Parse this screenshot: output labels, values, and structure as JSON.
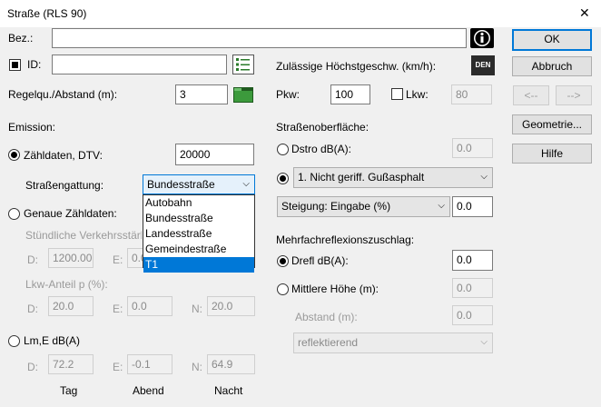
{
  "window": {
    "title": "Straße (RLS 90)",
    "close_glyph": "✕"
  },
  "bez": {
    "label": "Bez.:",
    "value": ""
  },
  "id": {
    "label": "ID:",
    "value": ""
  },
  "regelqu": {
    "label": "Regelqu./Abstand (m):",
    "value": "3"
  },
  "speed": {
    "label": "Zulässige Höchstgeschw. (km/h):",
    "den_label": "DEN",
    "pkw_label": "Pkw:",
    "pkw_value": "100",
    "lkw_label": "Lkw:",
    "lkw_value": "80"
  },
  "buttons": {
    "ok": "OK",
    "cancel": "Abbruch",
    "prev": "<--",
    "next": "-->",
    "geometry": "Geometrie...",
    "help": "Hilfe"
  },
  "emission": {
    "heading": "Emission:",
    "dtv_label": "Zähldaten, DTV:",
    "dtv_value": "20000",
    "road_type_label": "Straßengattung:",
    "road_type_selected": "Bundesstraße",
    "road_type_options": [
      "Autobahn",
      "Bundesstraße",
      "Landesstraße",
      "Gemeindestraße",
      "T1"
    ],
    "exact_label": "Genaue Zähldaten:",
    "traffic_label": "Stündliche Verkehrsstärke M (Kfz/h):",
    "traffic_d_label": "D:",
    "traffic_d_value": "1200.00",
    "traffic_e_label": "E:",
    "traffic_e_value": "0.0",
    "lkw_label": "Lkw-Anteil p (%):",
    "lkw_d_label": "D:",
    "lkw_d_value": "20.0",
    "lkw_e_label": "E:",
    "lkw_e_value": "0.0",
    "lkw_n_label": "N:",
    "lkw_n_value": "20.0",
    "lme_label": "Lm,E dB(A)",
    "lme_d_label": "D:",
    "lme_d_value": "72.2",
    "lme_e_label": "E:",
    "lme_e_value": "-0.1",
    "lme_n_label": "N:",
    "lme_n_value": "64.9",
    "col_day": "Tag",
    "col_evening": "Abend",
    "col_night": "Nacht"
  },
  "surface": {
    "heading": "Straßenoberfläche:",
    "dstro_label": "Dstro dB(A):",
    "dstro_value": "0.0",
    "surface_selected": "1. Nicht geriff. Gußasphalt",
    "slope_selected": "Steigung: Eingabe (%)",
    "slope_value": "0.0"
  },
  "reflection": {
    "heading": "Mehrfachreflexionszuschlag:",
    "drefl_label": "Drefl dB(A):",
    "drefl_value": "0.0",
    "height_label": "Mittlere Höhe (m):",
    "height_value": "0.0",
    "distance_label": "Abstand (m):",
    "distance_value": "0.0",
    "reflect_selected": "reflektierend"
  },
  "colors": {
    "accent": "#0078d7",
    "window_bg": "#f0f0f0"
  }
}
